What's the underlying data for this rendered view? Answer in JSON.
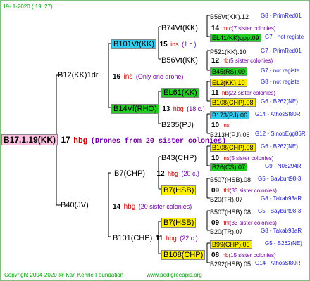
{
  "header": {
    "date": "19-  1-2020 ( 19: 27)"
  },
  "footer": {
    "copyright": "Copyright 2004-2020 @ Karl Kehrle Foundation",
    "url": "www.pedigreeapis.org"
  },
  "root": {
    "name": "B17.1.19(KK)",
    "count": "17",
    "unit": "hbg",
    "note": "(Drones from 20 sister colonies)"
  },
  "gen1": [
    {
      "name": "B12(KK)1dr",
      "count": "16",
      "unit": "ins",
      "note": "(Only one drone)"
    },
    {
      "name": "B40(JV)",
      "count": "14",
      "unit": "hbg",
      "note": "(20 sister colonies)"
    }
  ],
  "gen2": [
    {
      "name": "B101Vt(KK)",
      "count": "15",
      "unit": "ins",
      "note": "(1 c.)"
    },
    {
      "name": "B14Vf(RHO)",
      "count": "13",
      "unit": "hbg",
      "note": "(18 c.)"
    },
    {
      "name": "B7(CHP)",
      "count": "12",
      "unit": "hbg",
      "note": "(20 c.)"
    },
    {
      "name": "B101(CHP)",
      "count": "11",
      "unit": "hbg",
      "note": "(22 c.)"
    }
  ],
  "gen3": [
    {
      "name": "B74Vt(KK)",
      "count": "14",
      "unit": "mrc",
      "note": "(7 sister colonies)"
    },
    {
      "name": "B56Vt(KK)",
      "count": "12",
      "unit": "hb",
      "note": "(5 sister colonies)"
    },
    {
      "name": "EL61(KK)",
      "count": "11",
      "unit": "hb",
      "note": "(22 sister colonies)"
    },
    {
      "name": "B235(PJ)",
      "count": "10",
      "unit": "ins",
      "note": ""
    },
    {
      "name": "B43(CHP)",
      "count": "10",
      "unit": "ins",
      "note": "(5 sister colonies)"
    },
    {
      "name": "B7(HSB)",
      "count": "09",
      "unit": "lthl",
      "note": "(33 sister colonies)"
    },
    {
      "name": "B7(HSB)",
      "count": "09",
      "unit": "lthl",
      "note": "(33 sister colonies)"
    },
    {
      "name": "B108(CHP)",
      "count": "08",
      "unit": "hb",
      "note": "(15 sister colonies)"
    }
  ],
  "gen4": [
    {
      "name": "B56Vt(KK).12",
      "tag": "G8 - PrimRed01"
    },
    {
      "name": "EL41(KK)gpp.09",
      "tag": "G7 - not registe"
    },
    {
      "name": "P521(KK).10",
      "tag": "G7 - PrimRed01"
    },
    {
      "name": "B45(RS).09",
      "tag": "G7 - not registe"
    },
    {
      "name": "EL2(KK).10",
      "tag": "G8 - not registe"
    },
    {
      "name": "B108(CHP).08",
      "tag": "G6 - B262(NE)"
    },
    {
      "name": "B173(PJ).06",
      "tag": "G14 - AthosSt80R"
    },
    {
      "name": "B213H(PJ).06",
      "tag": "G12 - SinopEgg86R"
    },
    {
      "name": "B108(CHP).08",
      "tag": "G6 - B262(NE)"
    },
    {
      "name": "B26(CS).07",
      "tag": "G9 - N06294R"
    },
    {
      "name": "B507(HSB).08",
      "tag": "G5 - Bayburt98-3"
    },
    {
      "name": "B20(TR).07",
      "tag": "G8 - Takab93aR"
    },
    {
      "name": "B507(HSB).08",
      "tag": "G5 - Bayburt98-3"
    },
    {
      "name": "B20(TR).07",
      "tag": "G8 - Takab93aR"
    },
    {
      "name": "B99(CHP).06",
      "tag": "G5 - B262(NE)"
    },
    {
      "name": "B292(HSB).05",
      "tag": "G14 - AthosSt80R"
    }
  ],
  "colors": {
    "cyan": "#33ccee",
    "green": "#22cc22",
    "yellow": "#ffee00",
    "pink": "#ffc0e0",
    "red": "#c00000",
    "purple": "#7000a0",
    "blue": "#2020c0"
  }
}
